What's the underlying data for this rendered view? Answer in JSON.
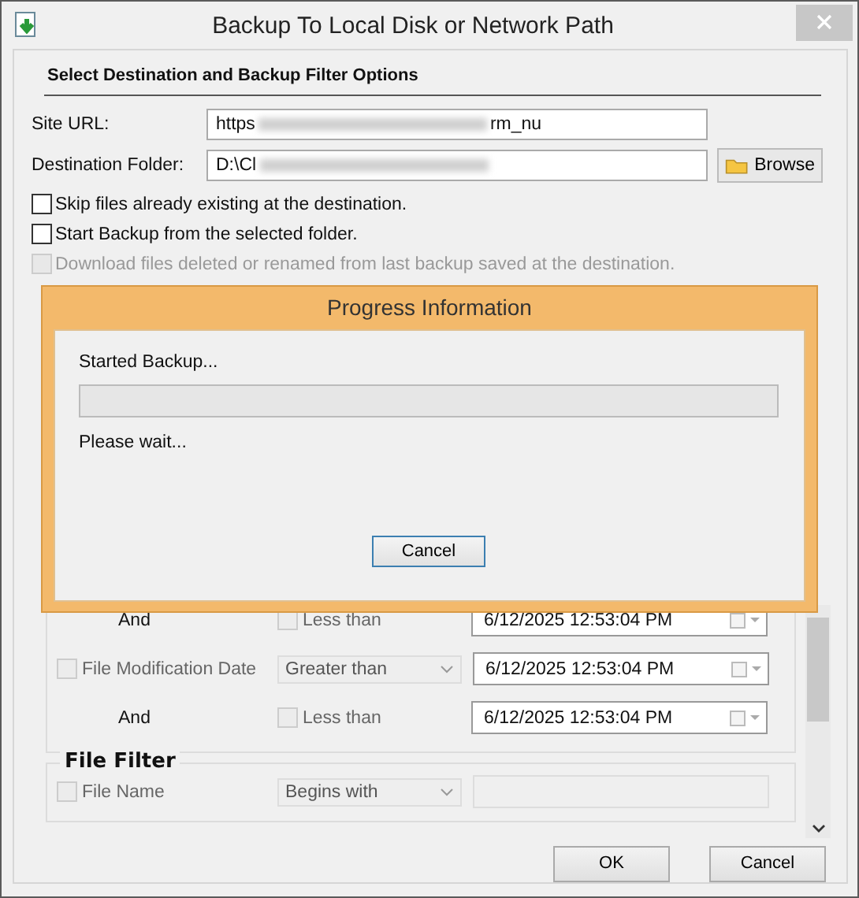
{
  "window": {
    "title": "Backup To Local Disk or Network Path"
  },
  "heading": "Select Destination and Backup Filter Options",
  "fields": [
    {
      "label": "Site URL:",
      "value_start": "https",
      "value_end": "rm_nu",
      "redacted": true
    },
    {
      "label": "Destination Folder:",
      "value_start": "D:\\Cl",
      "redacted": true
    }
  ],
  "browse_button": "Browse",
  "options": [
    {
      "label": "Skip files already existing at the destination.",
      "checked": false,
      "disabled": false
    },
    {
      "label": "Start Backup from the selected folder.",
      "checked": false,
      "disabled": false
    },
    {
      "label": "Download files deleted or renamed from last backup saved at the destination.",
      "checked": false,
      "disabled": true
    }
  ],
  "date_filter": {
    "rows": [
      {
        "kind": "and",
        "label": "And",
        "check_label": "Less than",
        "checked": false,
        "value": "6/12/2025 12:53:04 PM"
      },
      {
        "kind": "criterion",
        "label": "File Modification Date",
        "checked": false,
        "operator": "Greater than",
        "value": "6/12/2025 12:53:04 PM"
      },
      {
        "kind": "and",
        "label": "And",
        "check_label": "Less than",
        "checked": false,
        "value": "6/12/2025 12:53:04 PM"
      }
    ]
  },
  "file_filter": {
    "legend": "File Filter",
    "rows": [
      {
        "kind": "text",
        "label": "File Name",
        "checked": false,
        "operator": "Begins with"
      }
    ]
  },
  "progress": {
    "title": "Progress Information",
    "status": "Started Backup...",
    "level": 0,
    "message": "Please wait...",
    "cancel": "Cancel"
  },
  "buttons": [
    "OK",
    "Cancel"
  ]
}
